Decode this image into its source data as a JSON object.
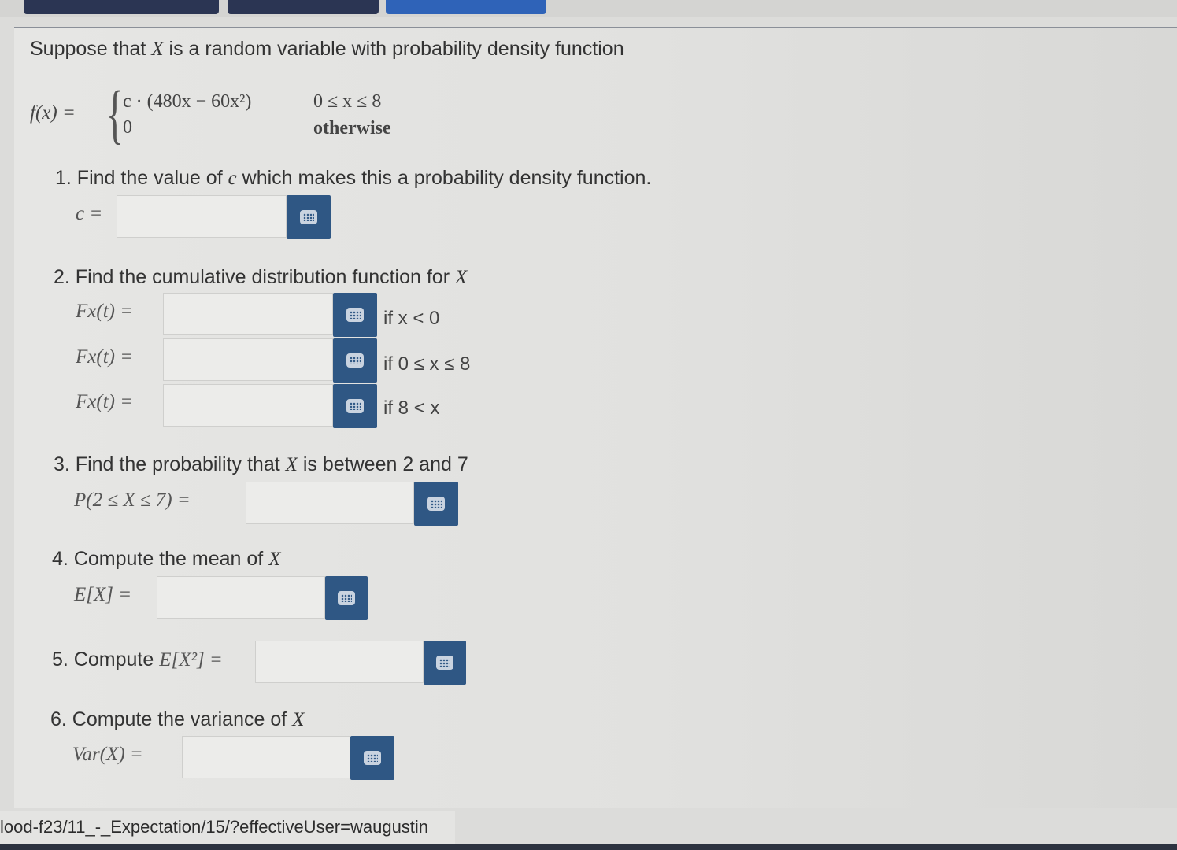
{
  "colors": {
    "button": "#2f5784",
    "field": "#ececea",
    "tab_dark": "#2b3553",
    "tab_blue": "#2f63b8"
  },
  "intro": {
    "prefix": "Suppose that ",
    "var": "X",
    "suffix": " is a random variable with probability density function"
  },
  "pdf": {
    "lhs": "f(x) =",
    "case1_expr": "c · (480x − 60x²)",
    "case1_cond": "0 ≤ x ≤ 8",
    "case2_expr": "0",
    "case2_cond": "otherwise"
  },
  "q1": {
    "prefix": "1. Find the value of ",
    "var": "c",
    "suffix": " which makes this a probability density function.",
    "label": "c ="
  },
  "q2": {
    "prefix": "2. Find the cumulative distribution function for ",
    "var": "X",
    "rows": [
      {
        "label": "Fx(t) =",
        "condition": "if x < 0"
      },
      {
        "label": "Fx(t) =",
        "condition": "if 0 ≤ x ≤ 8"
      },
      {
        "label": "Fx(t) =",
        "condition": "if 8 < x"
      }
    ]
  },
  "q3": {
    "prefix": "3. Find the probability that ",
    "var": "X",
    "suffix": " is between 2 and 7",
    "label": "P(2 ≤ X ≤ 7) ="
  },
  "q4": {
    "prefix": "4. Compute the mean of ",
    "var": "X",
    "label": "E[X] ="
  },
  "q5": {
    "prefix": "5. Compute ",
    "expr": "E[X²] ="
  },
  "q6": {
    "prefix": "6. Compute the variance of ",
    "var": "X",
    "label": "Var(X) ="
  },
  "status_url": "lood-f23/11_-_Expectation/15/?effectiveUser=waugustin",
  "icons": {
    "equation_editor": "keyboard-icon"
  }
}
